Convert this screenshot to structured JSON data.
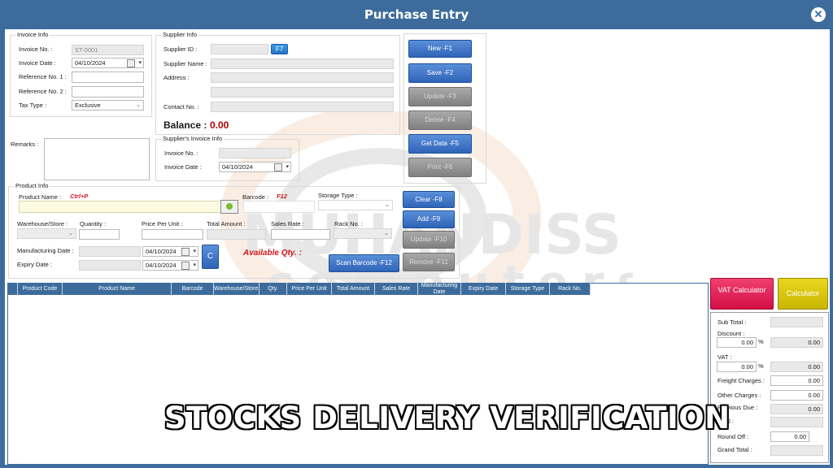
{
  "window": {
    "title": "Purchase Entry",
    "close_icon": "close-icon"
  },
  "invoice_info": {
    "group": "Invoice Info",
    "invoice_no_label": "Invoice No. :",
    "invoice_no_value": "ST-0001",
    "invoice_date_label": "Invoice Date :",
    "invoice_date_value": "04/10/2024",
    "ref1_label": "Reference No. 1 :",
    "ref2_label": "Reference No. 2 :",
    "tax_type_label": "Tax Type :",
    "tax_type_value": "Exclusive"
  },
  "supplier_info": {
    "group": "Supplier Info",
    "supplier_id_label": "Supplier ID :",
    "f7_label": "F7",
    "supplier_name_label": "Supplier Name :",
    "address_label": "Address :",
    "contact_label": "Contact No. :",
    "balance_label": "Balance :",
    "balance_value": "0.00"
  },
  "remarks_label": "Remarks :",
  "suppliers_invoice": {
    "group": "Supplier's Invoice Info",
    "invoice_no_label": "Invoice No. :",
    "invoice_date_label": "Invoice Date :",
    "invoice_date_value": "04/10/2024"
  },
  "actions": {
    "new": "New  -F1",
    "save": "Save  -F2",
    "update": "Update  -F3",
    "delete": "Delete  -F4",
    "get_data": "Get Data  -F5",
    "print": "Print  -F6"
  },
  "product_info": {
    "group": "Product Info",
    "product_name_label": "Product Name :",
    "ctrl_p": "Ctrl+P",
    "barcode_label": "Barcode :",
    "f12": "F12",
    "storage_type_label": "Storage Type :",
    "warehouse_label": "Warehouse/Store :",
    "quantity_label": "Quantity :",
    "ppu_label": "Price Per Unit :",
    "total_amount_label": "Total Amount :",
    "sales_rate_label": "Sales Rate :",
    "rack_no_label": "Rack No. :",
    "mfg_date_label": "Manufacturing Date :",
    "mfg_date_value": "04/10/2024",
    "expiry_label": "Expiry Date :",
    "expiry_value": "04/10/2024",
    "c_button": "C",
    "available_qty": "Available Qty. :",
    "clear": "Clear  -F8",
    "add": "Add  -F9",
    "update": "Update  -F10",
    "remove": "Remove  -F11",
    "scan_barcode": "Scan Barcode  -F12"
  },
  "grid": {
    "columns": [
      "Product Code",
      "Product Name",
      "Barcode",
      "Warehouse/Store",
      "Qty.",
      "Price Per Unit",
      "Total Amount",
      "Sales Rate",
      "Manufacturing Date",
      "Expiry Date",
      "Storage Type",
      "Rack No."
    ]
  },
  "calculators": {
    "vat": "VAT Calculator",
    "calc": "Calculator"
  },
  "totals": {
    "sub_total_label": "Sub Total :",
    "discount_label": "Discount :",
    "discount_pct": "0.00",
    "discount_amt": "0.00",
    "vat_label": "VAT :",
    "vat_pct": "0.00",
    "vat_amt": "0.00",
    "pct_sign": "%",
    "freight_label": "Freight Charges :",
    "freight_value": "0.00",
    "other_label": "Other Charges :",
    "other_value": "0.00",
    "prev_due_label": "Previous Due :",
    "prev_due_value": "0.00",
    "total_label": "Total :",
    "round_off_label": "Round Off :",
    "round_off_value": "0.00",
    "grand_total_label": "Grand Total :"
  },
  "overlay_caption": "STOCKS DELIVERY VERIFICATION",
  "colors": {
    "titlebar": "#3d6c9c",
    "button_blue": "#2f64b8",
    "vat_button": "#e0174f",
    "calc_button": "#d8c400"
  }
}
